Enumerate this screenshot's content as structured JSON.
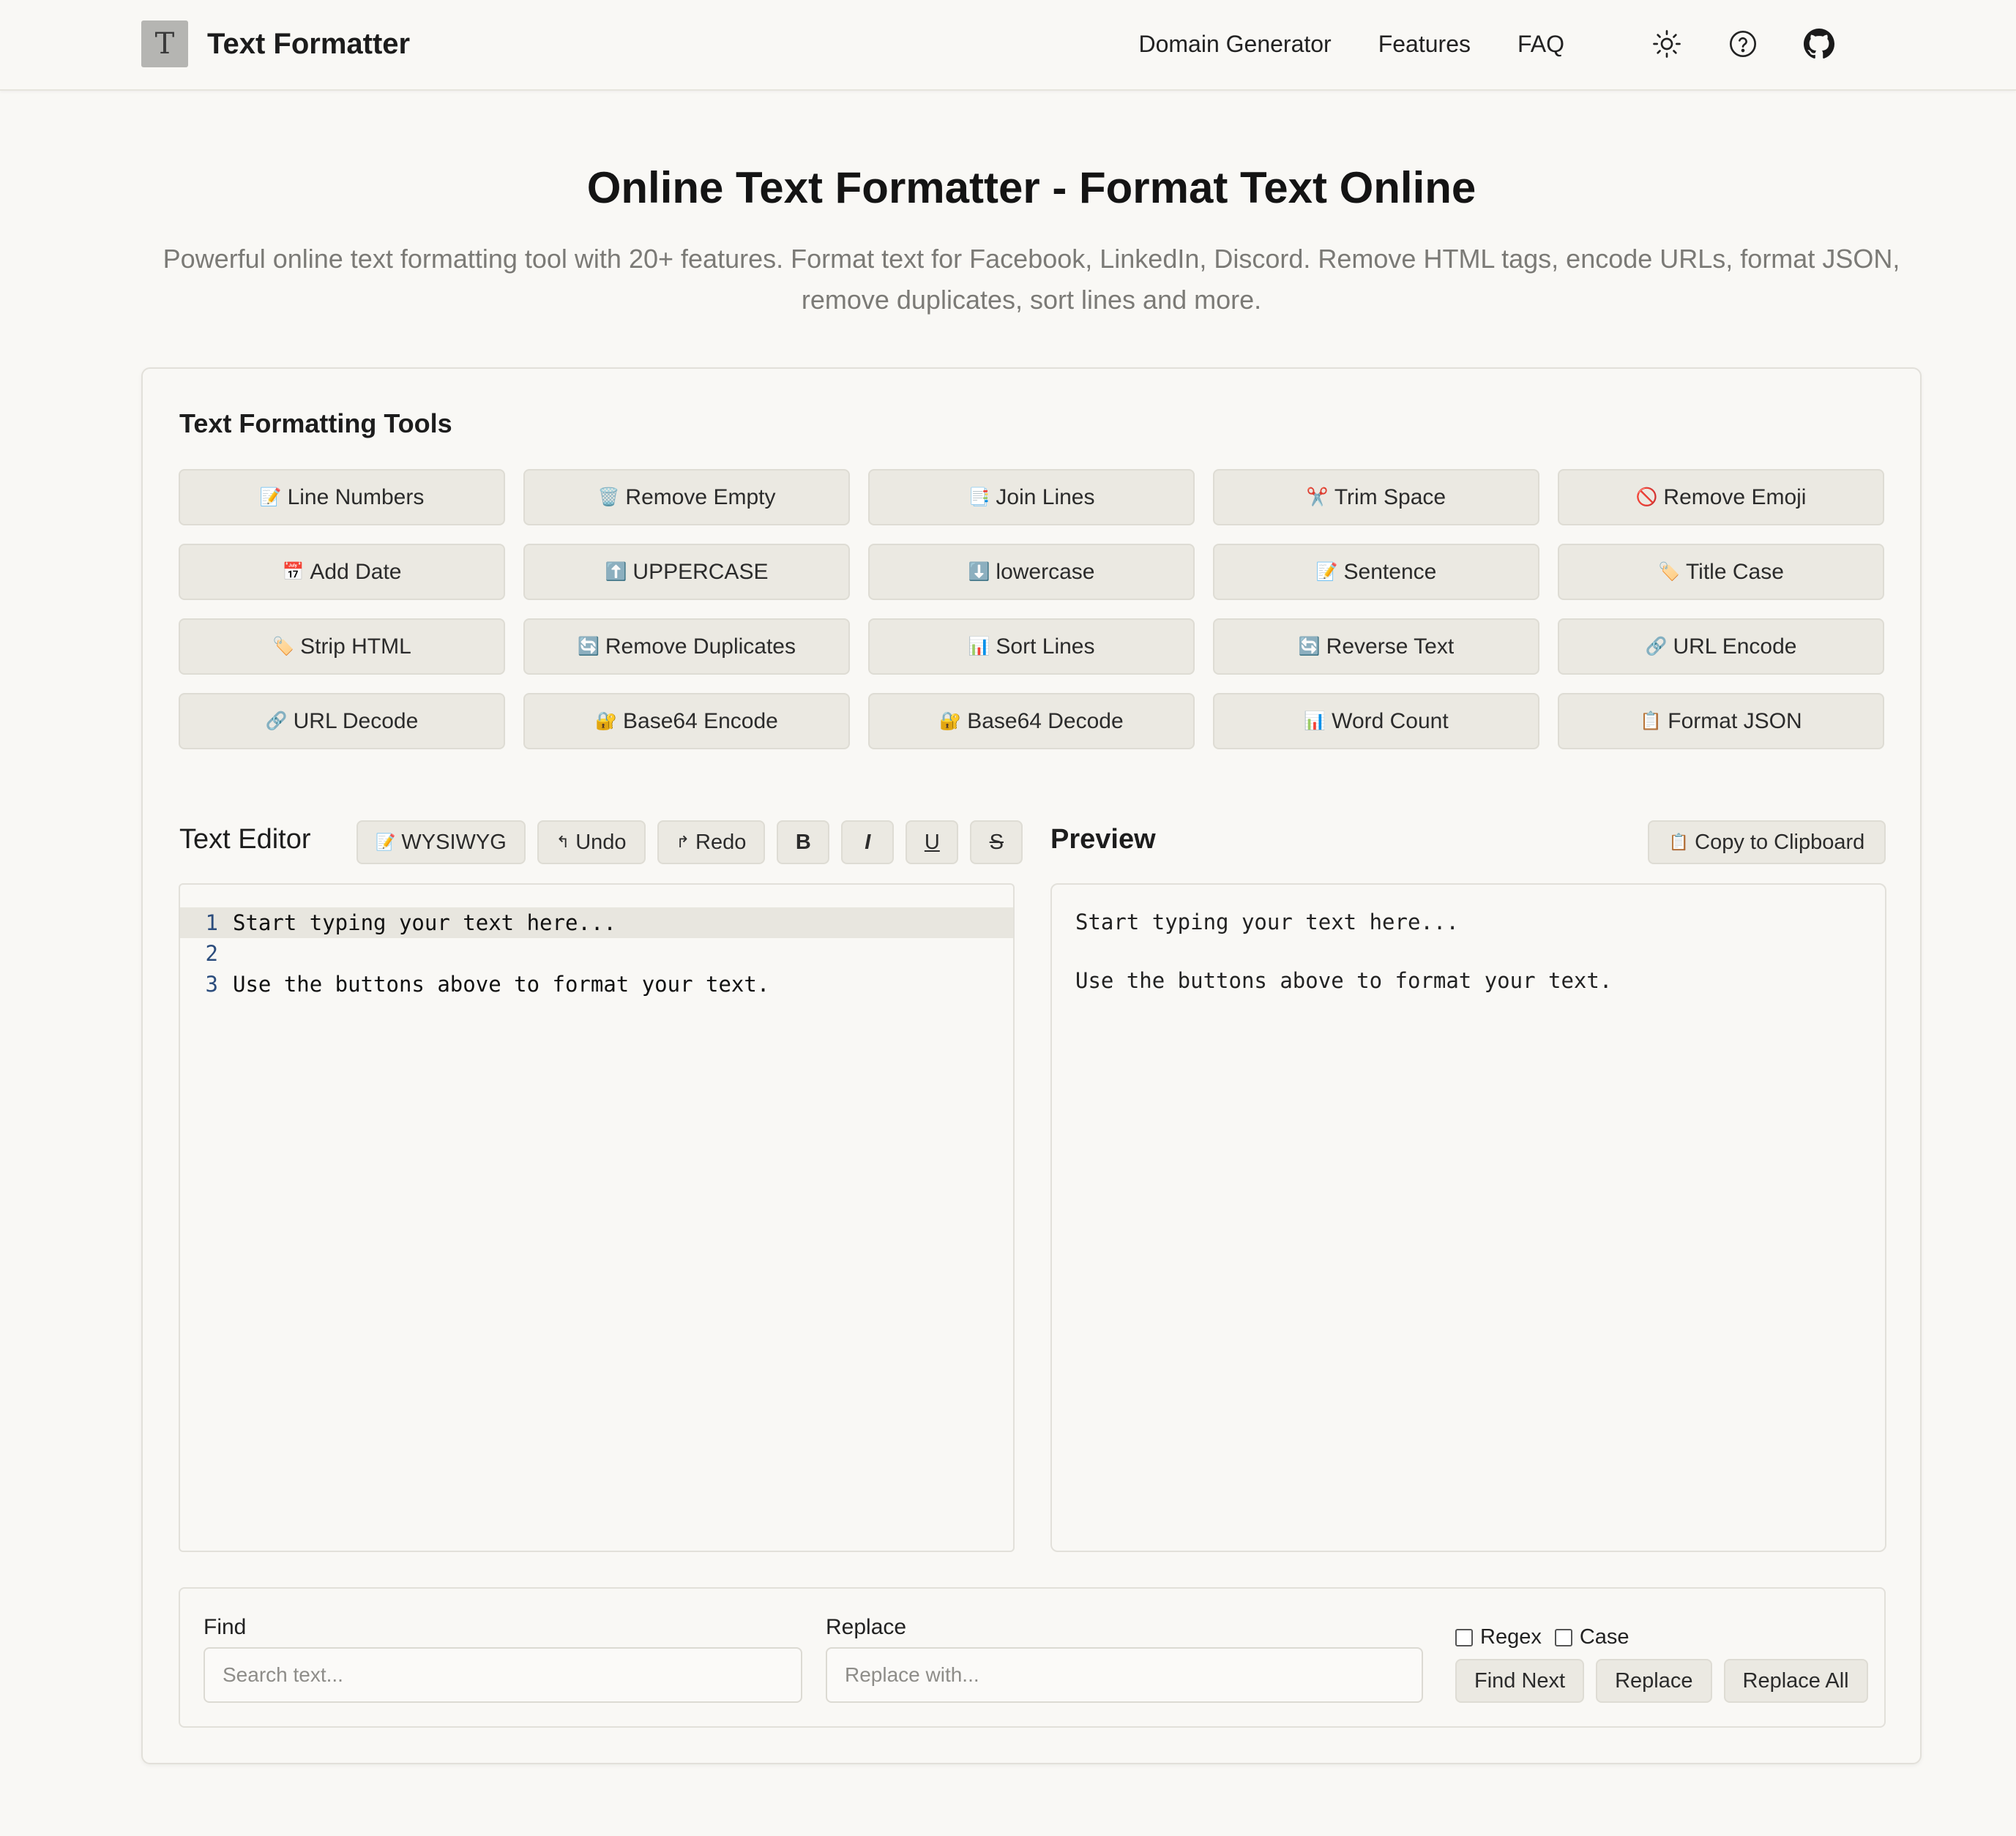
{
  "header": {
    "logo_letter": "T",
    "brand": "Text Formatter",
    "nav": [
      "Domain Generator",
      "Features",
      "FAQ"
    ],
    "icons": [
      "sun-icon",
      "help-circle-icon",
      "github-icon"
    ]
  },
  "hero": {
    "title": "Online Text Formatter - Format Text Online",
    "subtitle_line1": "Powerful online text formatting tool with 20+ features. Format text for Facebook, LinkedIn, Discord. Remove HTML tags, encode URLs, format JSON,",
    "subtitle_line2": "remove duplicates, sort lines and more."
  },
  "tools": {
    "title": "Text Formatting Tools",
    "buttons": [
      {
        "icon": "📝",
        "label": "Line Numbers"
      },
      {
        "icon": "🗑️",
        "label": "Remove Empty"
      },
      {
        "icon": "📑",
        "label": "Join Lines"
      },
      {
        "icon": "✂️",
        "label": "Trim Space"
      },
      {
        "icon": "🚫",
        "label": "Remove Emoji"
      },
      {
        "icon": "📅",
        "label": "Add Date"
      },
      {
        "icon": "⬆️",
        "label": "UPPERCASE"
      },
      {
        "icon": "⬇️",
        "label": "lowercase"
      },
      {
        "icon": "📝",
        "label": "Sentence"
      },
      {
        "icon": "🏷️",
        "label": "Title Case"
      },
      {
        "icon": "🏷️",
        "label": "Strip HTML"
      },
      {
        "icon": "🔄",
        "label": "Remove Duplicates"
      },
      {
        "icon": "📊",
        "label": "Sort Lines"
      },
      {
        "icon": "🔄",
        "label": "Reverse Text"
      },
      {
        "icon": "🔗",
        "label": "URL Encode"
      },
      {
        "icon": "🔗",
        "label": "URL Decode"
      },
      {
        "icon": "🔐",
        "label": "Base64 Encode"
      },
      {
        "icon": "🔐",
        "label": "Base64 Decode"
      },
      {
        "icon": "📊",
        "label": "Word Count"
      },
      {
        "icon": "📋",
        "label": "Format JSON"
      }
    ]
  },
  "editor": {
    "title": "Text Editor",
    "toolbar": {
      "wysiwyg_icon": "📝",
      "wysiwyg": "WYSIWYG",
      "undo_icon": "↰",
      "undo": "Undo",
      "redo_icon": "↱",
      "redo": "Redo",
      "bold": "B",
      "italic": "I",
      "underline": "U",
      "strike": "S"
    },
    "lines": [
      {
        "num": "1",
        "text": "Start typing your text here..."
      },
      {
        "num": "2",
        "text": ""
      },
      {
        "num": "3",
        "text": "Use the buttons above to format your text."
      }
    ]
  },
  "preview": {
    "title": "Preview",
    "copy_icon": "📋",
    "copy_label": "Copy to Clipboard",
    "line1": "Start typing your text here...",
    "line2": "Use the buttons above to format your text."
  },
  "find_replace": {
    "find_label": "Find",
    "find_placeholder": "Search text...",
    "replace_label": "Replace",
    "replace_placeholder": "Replace with...",
    "regex_label": "Regex",
    "case_label": "Case",
    "find_next": "Find Next",
    "replace": "Replace",
    "replace_all": "Replace All"
  }
}
